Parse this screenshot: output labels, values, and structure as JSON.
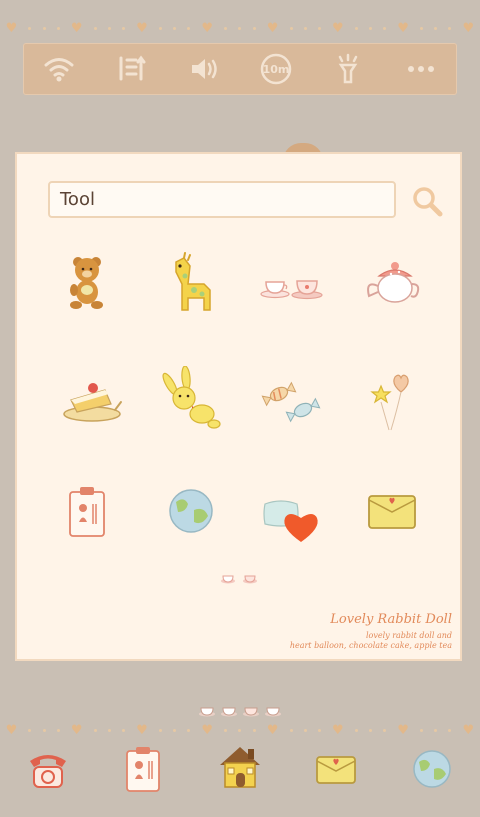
{
  "toolbar": {
    "icons": [
      "wifi-icon",
      "data-sync-icon",
      "volume-icon",
      "timeout-10m-icon",
      "flashlight-icon",
      "more-icon"
    ],
    "timeout_label": "10m"
  },
  "search": {
    "value": "Tool"
  },
  "apps": [
    {
      "icon": "teddy-bear-icon"
    },
    {
      "icon": "giraffe-icon"
    },
    {
      "icon": "tea-cups-icon"
    },
    {
      "icon": "teapot-icon"
    },
    {
      "icon": "cake-icon"
    },
    {
      "icon": "rabbit-doll-icon"
    },
    {
      "icon": "candy-icon"
    },
    {
      "icon": "balloons-icon"
    },
    {
      "icon": "contacts-card-icon"
    },
    {
      "icon": "globe-icon"
    },
    {
      "icon": "pillow-heart-icon"
    },
    {
      "icon": "envelope-icon"
    }
  ],
  "caption": {
    "title": "Lovely Rabbit Doll",
    "line1": "lovely rabbit doll and",
    "line2": "heart balloon, chocolate cake, apple tea"
  },
  "dock": [
    {
      "icon": "phone-icon"
    },
    {
      "icon": "contacts-icon"
    },
    {
      "icon": "home-icon"
    },
    {
      "icon": "messages-icon"
    },
    {
      "icon": "browser-icon"
    }
  ],
  "colors": {
    "background": "#c9bfb4",
    "panel": "#fff4e8",
    "toolbar": "#d9b99a",
    "accent": "#e28a5a"
  }
}
